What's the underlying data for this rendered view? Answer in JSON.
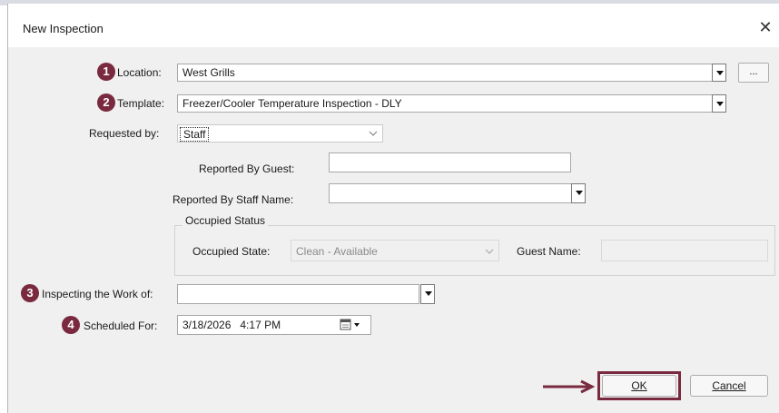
{
  "dialog": {
    "title": "New Inspection",
    "close_glyph": "✕"
  },
  "steps": [
    "1",
    "2",
    "3",
    "4"
  ],
  "location": {
    "label": "Location:",
    "value": "West Grills",
    "ellipsis": "..."
  },
  "template": {
    "label": "Template:",
    "value": "Freezer/Cooler Temperature Inspection - DLY"
  },
  "requested_by": {
    "label": "Requested by:",
    "value": "Staff"
  },
  "reported_by_guest": {
    "label": "Reported By Guest:",
    "value": ""
  },
  "reported_by_staff": {
    "label": "Reported By Staff Name:",
    "value": ""
  },
  "occupied_status": {
    "group_title": "Occupied Status",
    "state_label": "Occupied State:",
    "state_value": "Clean - Available",
    "guest_label": "Guest Name:",
    "guest_value": ""
  },
  "inspecting": {
    "label": "Inspecting the Work of:",
    "value": ""
  },
  "scheduled": {
    "label": "Scheduled For:",
    "value": "3/18/2026   4:17 PM"
  },
  "buttons": {
    "ok": "OK",
    "cancel": "Cancel"
  },
  "colors": {
    "accent": "#7a2a3f",
    "dialog_bg": "#f0f0f0"
  },
  "icons": [
    "close-icon",
    "dropdown-arrow-icon",
    "chevron-down-icon",
    "calendar-icon",
    "arrow-right-icon"
  ]
}
